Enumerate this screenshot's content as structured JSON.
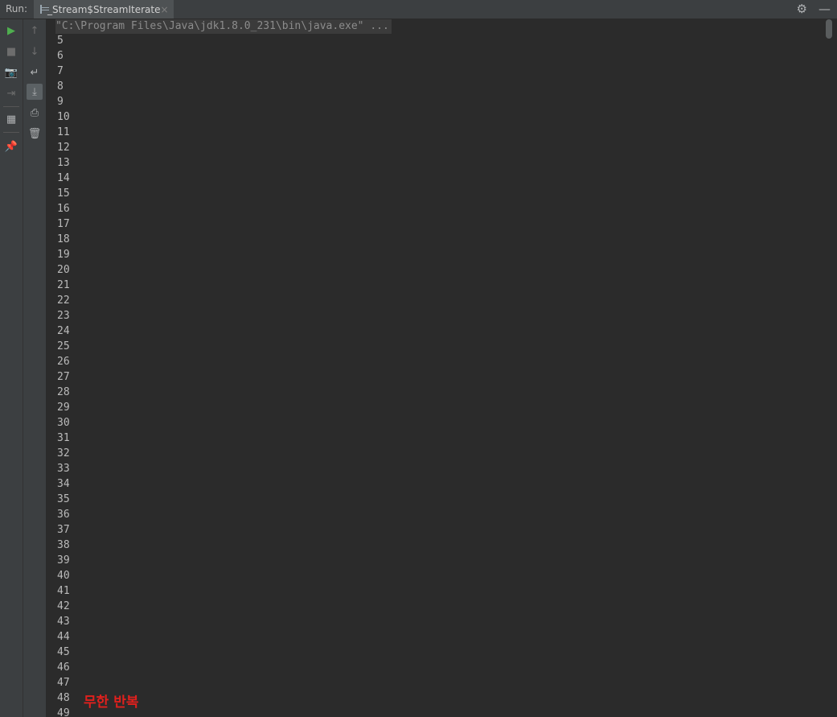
{
  "toolbar": {
    "run_label": "Run:",
    "tab_label": "_Stream$StreamIterate",
    "tab_close": "×",
    "settings_icon": "⚙",
    "minimize_icon": "—"
  },
  "left_tools_1": [
    {
      "name": "rerun-icon",
      "glyph": "▶",
      "color": "#4faf4f"
    },
    {
      "name": "stop-icon",
      "glyph": "■",
      "color": "#6d6d6d"
    },
    {
      "name": "dump-threads-icon",
      "glyph": "📷",
      "color": "#6d6d6d"
    },
    {
      "name": "exit-icon",
      "glyph": "⇥",
      "color": "#6d6d6d"
    },
    {
      "name": "layout-icon",
      "glyph": "▦",
      "color": "#afb1b3"
    },
    {
      "name": "pin-icon",
      "glyph": "📌",
      "color": "#afb1b3"
    }
  ],
  "left_tools_2": [
    {
      "name": "up-arrow-icon",
      "glyph": "↑",
      "color": "#6d6d6d"
    },
    {
      "name": "down-arrow-icon",
      "glyph": "↓",
      "color": "#6d6d6d"
    },
    {
      "name": "soft-wrap-icon",
      "glyph": "↵",
      "color": "#afb1b3"
    },
    {
      "name": "scroll-to-end-icon",
      "glyph": "⤓",
      "color": "#afb1b3"
    },
    {
      "name": "print-icon",
      "glyph": "⎙",
      "color": "#afb1b3"
    },
    {
      "name": "trash-icon",
      "glyph": "🗑",
      "color": "#afb1b3"
    }
  ],
  "console": {
    "command": "\"C:\\Program Files\\Java\\jdk1.8.0_231\\bin\\java.exe\" ...",
    "lines": [
      "5",
      "6",
      "7",
      "8",
      "9",
      "10",
      "11",
      "12",
      "13",
      "14",
      "15",
      "16",
      "17",
      "18",
      "19",
      "20",
      "21",
      "22",
      "23",
      "24",
      "25",
      "26",
      "27",
      "28",
      "29",
      "30",
      "31",
      "32",
      "33",
      "34",
      "35",
      "36",
      "37",
      "38",
      "39",
      "40",
      "41",
      "42",
      "43",
      "44",
      "45",
      "46",
      "47",
      "48",
      "49"
    ]
  },
  "annotation": "무한 반복"
}
